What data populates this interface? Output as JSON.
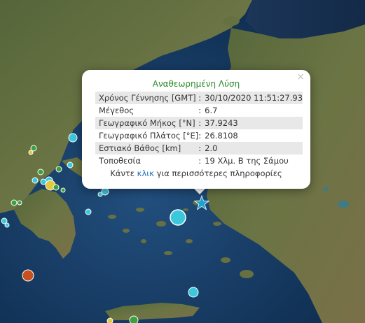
{
  "popup": {
    "title": "Αναθεωρημένη Λύση",
    "close": "×",
    "rows": [
      {
        "label": "Χρόνος Γέννησης [GMT]",
        "value": "30/10/2020 11:51:27.93"
      },
      {
        "label": "Μέγεθος",
        "value": "6.7"
      },
      {
        "label": "Γεωγραφικό Μήκος [°N]",
        "value": "37.9243"
      },
      {
        "label": "Γεωγραφικό Πλάτος [°E]",
        "value": "26.8108"
      },
      {
        "label": "Εστιακό Βάθος [km]",
        "value": "2.0"
      },
      {
        "label": "Τοποθεσία",
        "value": "19 Χλμ. Β της Σάμου"
      }
    ],
    "more_prefix": "Κάντε",
    "more_link": "κλικ",
    "more_suffix": "για περισσότερες πληροφορίες"
  },
  "colors": {
    "sea_deep": "#102e52",
    "sea_shallow": "#1d4a78",
    "land": "#5e6e3c",
    "title_green": "#2a8a2a",
    "link_blue": "#2471b8",
    "marker_cyan": "#3cc8dc",
    "marker_green": "#3ca03c",
    "marker_yellow": "#e6c83c",
    "marker_orange": "#c8501e",
    "star": "#1ea0d2"
  },
  "icons": {
    "close": "close-icon",
    "epicenter": "star-icon"
  }
}
